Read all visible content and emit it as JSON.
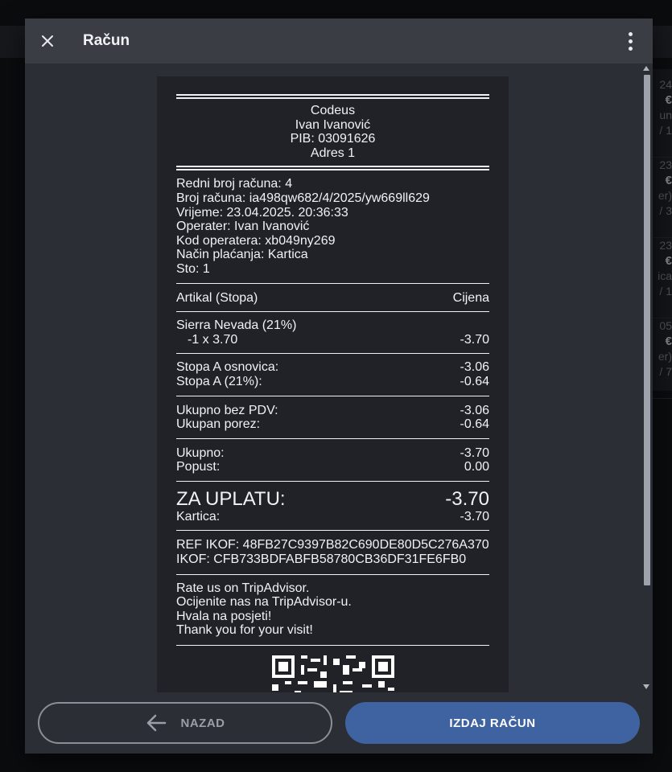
{
  "background": {
    "cards": [
      {
        "top": "24",
        "price": "€",
        "sub": "un",
        "count": "/ 1"
      },
      {
        "top": "23",
        "price": "€",
        "sub": "er)",
        "count": "/ 3"
      },
      {
        "top": "23",
        "price": "€",
        "sub": "ica",
        "count": "/ 1"
      },
      {
        "top": "05",
        "price": "€",
        "sub": "er)",
        "count": "/ 7"
      }
    ]
  },
  "dialog": {
    "title": "Račun",
    "close_icon": "close-icon",
    "menu_icon": "more-vertical-icon"
  },
  "receipt": {
    "company": "Codeus",
    "owner": "Ivan Ivanović",
    "pib": "PIB: 03091626",
    "address": "Adres 1",
    "info": [
      "Redni broj računa: 4",
      "Broj računa: ia498qw682/4/2025/yw669ll629",
      "Vrijeme: 23.04.2025. 20:36:33",
      "Operater: Ivan Ivanović",
      "Kod operatera: xb049ny269",
      "Način plaćanja: Kartica",
      "Sto: 1"
    ],
    "header_item": "Artikal (Stopa)",
    "header_price": "Cijena",
    "item_name": "Sierra Nevada (21%)",
    "item_qty": "-1 x 3.70",
    "item_total": "-3.70",
    "tax_base_label": "Stopa A osnovica:",
    "tax_base_value": "-3.06",
    "tax_rate_label": "Stopa A (21%):",
    "tax_rate_value": "-0.64",
    "net_label": "Ukupno bez PDV:",
    "net_value": "-3.06",
    "tax_total_label": "Ukupan porez:",
    "tax_total_value": "-0.64",
    "total_label": "Ukupno:",
    "total_value": "-3.70",
    "discount_label": "Popust:",
    "discount_value": "0.00",
    "pay_label": "ZA UPLATU:",
    "pay_value": "-3.70",
    "card_label": "Kartica:",
    "card_value": "-3.70",
    "ref_ikof": "REF IKOF: 48FB27C9397B82C690DE80D5C276A370",
    "ikof": "IKOF: CFB733BDFABFB58780CB36DF31FE6FB0",
    "messages": [
      "Rate us on TripAdvisor.",
      "Ocijenite nas na TripAdvisor-u.",
      "Hvala na posjeti!",
      "Thank you for your visit!"
    ]
  },
  "footer": {
    "back_label": "NAZAD",
    "back_icon": "arrow-left-icon",
    "issue_label": "IZDAJ RAČUN"
  },
  "colors": {
    "primary": "#3f62a0",
    "dialog_bg": "#2b2e34",
    "receipt_bg": "#202228"
  }
}
